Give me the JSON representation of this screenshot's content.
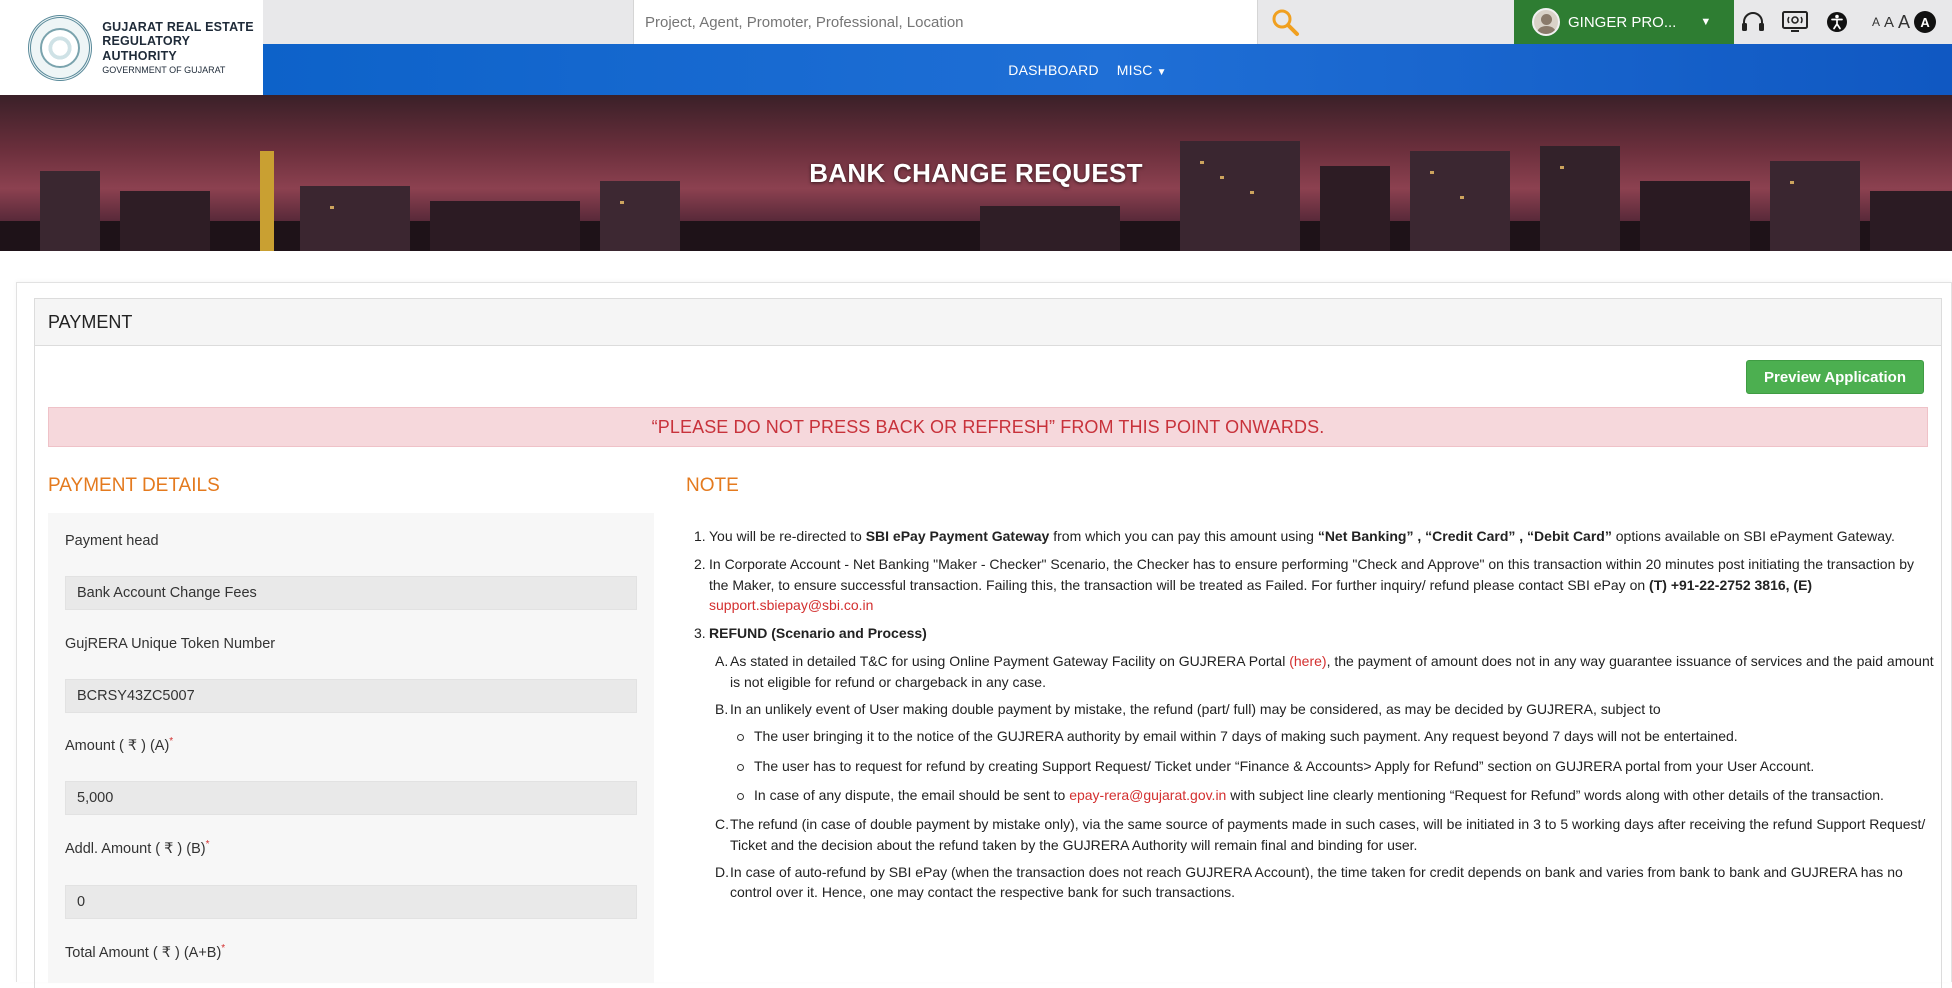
{
  "brand": {
    "line1": "GUJARAT REAL ESTATE",
    "line1b": "REGULATORY AUTHORITY",
    "line2": "GOVERNMENT OF GUJARAT"
  },
  "search": {
    "placeholder": "Project, Agent, Promoter, Professional, Location"
  },
  "user": {
    "name": "GINGER PRO..."
  },
  "font_sizes": [
    "A",
    "A",
    "A"
  ],
  "contrast_label": "A",
  "nav": {
    "items": [
      {
        "label": "DASHBOARD"
      },
      {
        "label": "MISC"
      }
    ]
  },
  "hero": {
    "title": "BANK CHANGE REQUEST"
  },
  "panel": {
    "title": "PAYMENT"
  },
  "preview_button": "Preview Application",
  "warning": "“PLEASE DO NOT PRESS BACK OR REFRESH” FROM THIS POINT ONWARDS.",
  "payment_details": {
    "title": "PAYMENT DETAILS",
    "fields": [
      {
        "label": "Payment head",
        "value": "Bank Account Change Fees",
        "required": ""
      },
      {
        "label": "GujRERA Unique Token Number",
        "value": "BCRSY43ZC5007",
        "required": ""
      },
      {
        "label": "Amount ( ₹ ) (A)",
        "value": "5,000",
        "required": "*"
      },
      {
        "label": "Addl. Amount ( ₹ ) (B)",
        "value": "0",
        "required": "*"
      },
      {
        "label": "Total Amount ( ₹ ) (A+B)",
        "value": "",
        "required": "*"
      }
    ]
  },
  "note": {
    "title": "NOTE",
    "n1": {
      "num": "1.",
      "a": "You will be re-directed to ",
      "b": "SBI ePay Payment Gateway",
      "c": " from which you can pay this amount using ",
      "d": "“Net Banking” , “Credit Card” , “Debit Card”",
      "e": " options available on SBI ePayment Gateway."
    },
    "n2": {
      "num": "2.",
      "a": "In Corporate Account - Net Banking \"Maker - Checker\" Scenario, the Checker has to ensure performing \"Check and Approve\" on this transaction within 20 minutes post initiating the transaction by the Maker, to ensure successful transaction. Failing this, the transaction will be treated as Failed. For further inquiry/ refund please contact SBI ePay on ",
      "b": "(T) +91-22-2752 3816, (E)",
      "c": " ",
      "email": "support.sbiepay@sbi.co.in"
    },
    "n3": {
      "num": "3.",
      "title": "REFUND (Scenario and Process)"
    },
    "sa": {
      "num": "A.",
      "a": "As stated in detailed T&C for using Online Payment Gateway Facility on GUJRERA Portal ",
      "link": "(here)",
      "b": ", the payment of amount does not in any way guarantee issuance of services and the paid amount is not eligible for refund or chargeback in any case."
    },
    "sb": {
      "num": "B.",
      "text": "In an unlikely event of User making double payment by mistake, the refund (part/ full) may be considered, as may be decided by GUJRERA, subject to"
    },
    "b1": "The user bringing it to the notice of the GUJRERA authority by email within 7 days of making such payment. Any request beyond 7 days will not be entertained.",
    "b2": "The user has to request for refund by creating Support Request/ Ticket under “Finance & Accounts> Apply for Refund” section on GUJRERA portal from your User Account.",
    "b3": {
      "a": "In case of any dispute, the email should be sent to ",
      "email": "epay-rera@gujarat.gov.in",
      "b": " with subject line clearly mentioning “Request for Refund” words along with other details of the transaction."
    },
    "sc": {
      "num": "C.",
      "text": "The refund (in case of double payment by mistake only), via the same source of payments made in such cases, will be initiated in 3 to 5 working days after receiving the refund Support Request/ Ticket and the decision about the refund taken by the GUJRERA Authority will remain final and binding for user."
    },
    "sd": {
      "num": "D.",
      "text": "In case of auto-refund by SBI ePay (when the transaction does not reach GUJRERA Account), the time taken for credit depends on bank and varies from bank to bank and GUJRERA has no control over it. Hence, one may contact the respective bank for such transactions."
    }
  },
  "colors": {
    "accent_orange": "#e47a1e",
    "nav_blue": "#1f6fd6",
    "user_green": "#2e7d32",
    "preview_green": "#4caf50",
    "warning_bg": "#f6d8dc",
    "warning_text": "#c8323b"
  },
  "icons": [
    "search-icon",
    "chevron-down-icon",
    "headset-icon",
    "screen-reader-icon",
    "accessibility-icon",
    "contrast-icon"
  ]
}
